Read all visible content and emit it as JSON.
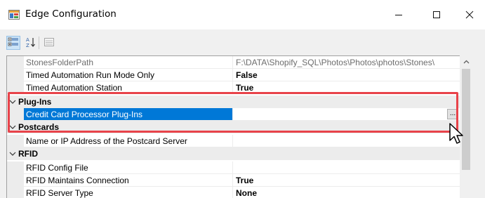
{
  "window": {
    "title": "Edge Configuration",
    "controls": {
      "minimize": "—",
      "maximize": "☐",
      "close": "✕"
    }
  },
  "toolbar": {
    "buttons": [
      {
        "name": "categorized",
        "icon": "categorized-view-icon",
        "active": true
      },
      {
        "name": "alphabetical",
        "icon": "sort-az-icon",
        "active": false
      },
      {
        "name": "property-pages",
        "icon": "property-pages-icon",
        "active": false,
        "disabled": true
      }
    ]
  },
  "grid": {
    "rows": [
      {
        "kind": "property",
        "name": "StonesFolderPath",
        "value": "F:\\DATA\\Shopify_SQL\\Photos\\Photos\\photos\\Stones\\",
        "style": "grey"
      },
      {
        "kind": "property",
        "name": "Timed Automation Run Mode Only",
        "value": "False",
        "style": "bold"
      },
      {
        "kind": "property",
        "name": "Timed Automation Station",
        "value": "True",
        "style": "bold"
      },
      {
        "kind": "category",
        "name": "Plug-Ins",
        "expanded": true
      },
      {
        "kind": "property",
        "name": "Credit Card Processor Plug-Ins",
        "value": "",
        "style": "selected",
        "button": "..."
      },
      {
        "kind": "category",
        "name": "Postcards",
        "expanded": true
      },
      {
        "kind": "property",
        "name": "Name or IP Address of the Postcard Server",
        "value": "",
        "style": "normal"
      },
      {
        "kind": "category",
        "name": "RFID",
        "expanded": true
      },
      {
        "kind": "property",
        "name": "RFID Config File",
        "value": "",
        "style": "normal"
      },
      {
        "kind": "property",
        "name": "RFID Maintains Connection",
        "value": "True",
        "style": "bold"
      },
      {
        "kind": "property",
        "name": "RFID Server Type",
        "value": "None",
        "style": "bold"
      }
    ]
  },
  "colors": {
    "selection": "#0078d7",
    "highlight_box": "#e8434a",
    "category_band": "#ececec"
  }
}
